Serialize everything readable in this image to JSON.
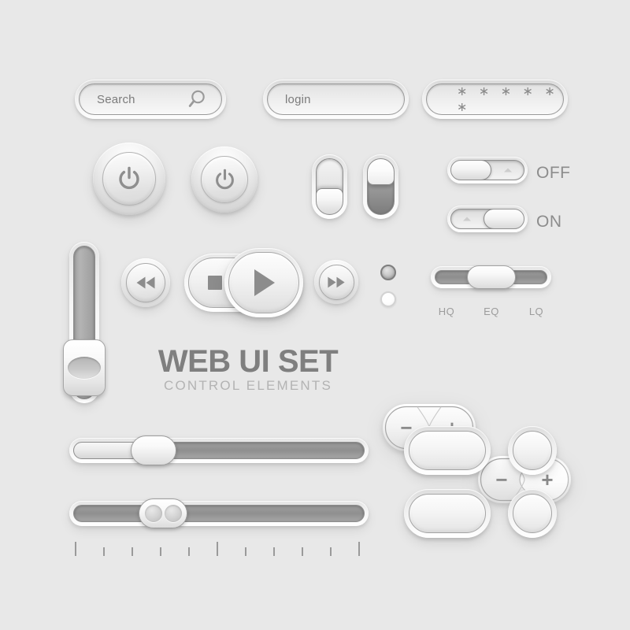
{
  "page": {
    "background_color": "#e8e8e8",
    "accent_gray": "#8c8c8c",
    "label_gray": "#9c9c9c"
  },
  "title": {
    "main": "WEB UI SET",
    "sub": "CONTROL ELEMENTS"
  },
  "fields": {
    "search": {
      "value": "Search",
      "icon": "search-icon"
    },
    "login": {
      "value": "login"
    },
    "password": {
      "value": "∗ ∗ ∗ ∗ ∗ ∗",
      "masked": true,
      "char_count": 6
    }
  },
  "power_buttons": [
    {
      "name": "power-button-large",
      "icon": "power-icon",
      "state": "large"
    },
    {
      "name": "power-button-small",
      "icon": "power-icon",
      "state": "small"
    }
  ],
  "vertical_toggles": [
    {
      "name": "vertical-toggle-off",
      "thumb_position": "bottom",
      "state": "off"
    },
    {
      "name": "vertical-toggle-on",
      "thumb_position": "top",
      "state": "on"
    }
  ],
  "switches": [
    {
      "label": "OFF",
      "thumb_position": "left",
      "state": "off"
    },
    {
      "label": "ON",
      "thumb_position": "right",
      "state": "on"
    }
  ],
  "media_controls": [
    {
      "name": "rewind-button",
      "icon": "rewind-icon"
    },
    {
      "name": "stop-button",
      "icon": "stop-icon"
    },
    {
      "name": "play-button",
      "icon": "play-icon"
    },
    {
      "name": "forward-button",
      "icon": "fast-forward-icon"
    }
  ],
  "leds": [
    {
      "name": "led-indicator-off",
      "state": "off"
    },
    {
      "name": "led-indicator-on",
      "state": "on"
    }
  ],
  "quality_slider": {
    "labels": [
      "HQ",
      "EQ",
      "LQ"
    ],
    "selected": "EQ",
    "thumb_percent": 50
  },
  "vertical_slider": {
    "name": "vertical-volume-slider",
    "thumb_percent": 74
  },
  "steppers": [
    {
      "name": "stepper-default",
      "minus": "−",
      "plus": "+",
      "active": "none"
    },
    {
      "name": "stepper-plus-active",
      "minus": "−",
      "plus": "+",
      "active": "plus"
    }
  ],
  "horizontal_sliders": [
    {
      "name": "progress-slider",
      "thumb_percent": 25,
      "fill_percent": 25,
      "handle": "plain"
    },
    {
      "name": "range-slider",
      "thumb_percent": 28,
      "fill_percent": 0,
      "handle": "dual-dot"
    }
  ],
  "ruler": {
    "tick_count": 11,
    "major_ticks": [
      1,
      6,
      11
    ],
    "major_height": 18,
    "minor_height": 11
  },
  "blank_buttons": [
    {
      "name": "blank-button-pill-1",
      "shape": "pill"
    },
    {
      "name": "blank-button-circle-1",
      "shape": "circle"
    },
    {
      "name": "blank-button-pill-2",
      "shape": "pill"
    },
    {
      "name": "blank-button-circle-2",
      "shape": "circle"
    }
  ]
}
